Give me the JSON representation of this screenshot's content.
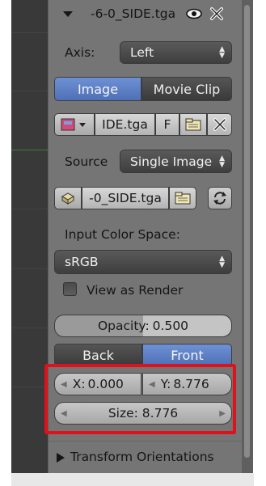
{
  "panel_header": {
    "title": "-6-0_SIDE.tga"
  },
  "axis": {
    "label": "Axis:",
    "value": "Left"
  },
  "source_type_tabs": [
    {
      "label": "Image",
      "active": true
    },
    {
      "label": "Movie Clip",
      "active": false
    }
  ],
  "image_block": {
    "name": "IDE.tga",
    "fake_user": "F"
  },
  "source": {
    "label": "Source",
    "value": "Single Image"
  },
  "file_path": {
    "value": "-0_SIDE.tga"
  },
  "color_space": {
    "label": "Input Color Space:",
    "value": "sRGB"
  },
  "view_as_render": {
    "label": "View as Render",
    "checked": false
  },
  "opacity": {
    "label": "Opacity:",
    "value": "0.500"
  },
  "side_tabs": [
    {
      "label": "Back",
      "active": false
    },
    {
      "label": "Front",
      "active": true
    }
  ],
  "offset": {
    "x_label": "X:",
    "x_value": "0.000",
    "y_label": "Y:",
    "y_value": "8.776"
  },
  "size": {
    "label": "Size:",
    "value": "8.776"
  },
  "transform_orientations": {
    "label": "Transform Orientations"
  },
  "colors": {
    "panel_bg": "#757575",
    "selected_tab": "#5679c0",
    "highlight": "#e0111a"
  },
  "icons": [
    "disclosure-triangle",
    "eye",
    "close-x",
    "image-browse",
    "folder",
    "close-x",
    "package",
    "folder",
    "reload",
    "chevron-right"
  ]
}
